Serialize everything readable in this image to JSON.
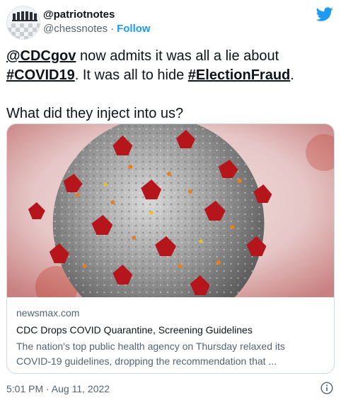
{
  "author": {
    "display_name": "@patriotnotes",
    "handle": "@chessnotes",
    "separator": "·",
    "follow_label": "Follow"
  },
  "tweet": {
    "mention": "@CDCgov",
    "text_1": " now admits it was all a lie about ",
    "hashtag_1": "#COVID19",
    "text_2": ". It was all to hide ",
    "hashtag_2": "#ElectionFraud",
    "text_3": ".",
    "line_2": "What did they inject into us?"
  },
  "card": {
    "domain": "newsmax.com",
    "title": "CDC Drops COVID Quarantine, Screening Guidelines",
    "description_line_1": "The nation's top public health agency on Thursday relaxed its",
    "description_line_2": "COVID-19 guidelines, dropping the recommendation that ..."
  },
  "footer": {
    "timestamp": "5:01 PM · Aug 11, 2022"
  },
  "colors": {
    "twitter_blue": "#1d9bf0",
    "text": "#0f1419",
    "secondary": "#536471",
    "border": "#cfd9de"
  },
  "icons": {
    "brand": "twitter-bird-icon",
    "info": "info-icon"
  }
}
